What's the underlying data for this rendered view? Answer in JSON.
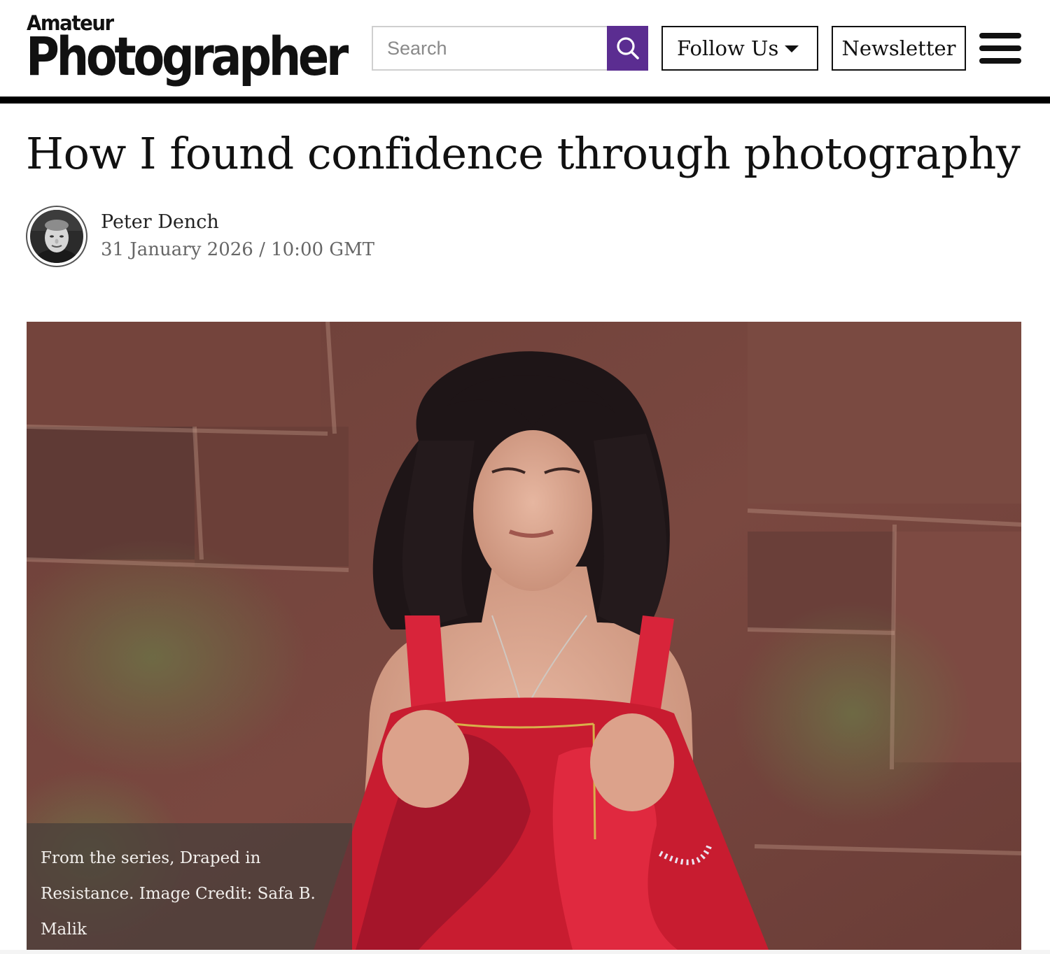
{
  "header": {
    "logo_top": "Amateur",
    "logo_main": "Photographer",
    "search_placeholder": "Search",
    "search_icon": "search-icon",
    "follow_label": "Follow Us",
    "newsletter_label": "Newsletter",
    "menu_icon": "hamburger-menu-icon"
  },
  "colors": {
    "accent": "#5b2d91",
    "rule": "#000000",
    "caption_bg": "#463e3a"
  },
  "article": {
    "title": "How I found confidence through photography",
    "author": "Peter Dench",
    "dateline": "31 January 2026 / 10:00 GMT",
    "image_caption": "From the series, Draped in Resistance. Image Credit: Safa B. Malik"
  }
}
